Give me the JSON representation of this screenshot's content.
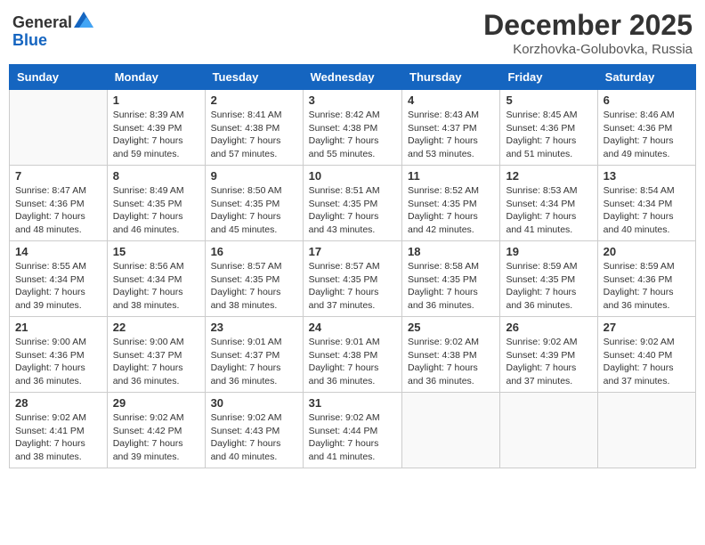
{
  "header": {
    "logo_general": "General",
    "logo_blue": "Blue",
    "title": "December 2025",
    "location": "Korzhovka-Golubovka, Russia"
  },
  "weekdays": [
    "Sunday",
    "Monday",
    "Tuesday",
    "Wednesday",
    "Thursday",
    "Friday",
    "Saturday"
  ],
  "weeks": [
    [
      {
        "day": "",
        "info": ""
      },
      {
        "day": "1",
        "info": "Sunrise: 8:39 AM\nSunset: 4:39 PM\nDaylight: 7 hours\nand 59 minutes."
      },
      {
        "day": "2",
        "info": "Sunrise: 8:41 AM\nSunset: 4:38 PM\nDaylight: 7 hours\nand 57 minutes."
      },
      {
        "day": "3",
        "info": "Sunrise: 8:42 AM\nSunset: 4:38 PM\nDaylight: 7 hours\nand 55 minutes."
      },
      {
        "day": "4",
        "info": "Sunrise: 8:43 AM\nSunset: 4:37 PM\nDaylight: 7 hours\nand 53 minutes."
      },
      {
        "day": "5",
        "info": "Sunrise: 8:45 AM\nSunset: 4:36 PM\nDaylight: 7 hours\nand 51 minutes."
      },
      {
        "day": "6",
        "info": "Sunrise: 8:46 AM\nSunset: 4:36 PM\nDaylight: 7 hours\nand 49 minutes."
      }
    ],
    [
      {
        "day": "7",
        "info": "Sunrise: 8:47 AM\nSunset: 4:36 PM\nDaylight: 7 hours\nand 48 minutes."
      },
      {
        "day": "8",
        "info": "Sunrise: 8:49 AM\nSunset: 4:35 PM\nDaylight: 7 hours\nand 46 minutes."
      },
      {
        "day": "9",
        "info": "Sunrise: 8:50 AM\nSunset: 4:35 PM\nDaylight: 7 hours\nand 45 minutes."
      },
      {
        "day": "10",
        "info": "Sunrise: 8:51 AM\nSunset: 4:35 PM\nDaylight: 7 hours\nand 43 minutes."
      },
      {
        "day": "11",
        "info": "Sunrise: 8:52 AM\nSunset: 4:35 PM\nDaylight: 7 hours\nand 42 minutes."
      },
      {
        "day": "12",
        "info": "Sunrise: 8:53 AM\nSunset: 4:34 PM\nDaylight: 7 hours\nand 41 minutes."
      },
      {
        "day": "13",
        "info": "Sunrise: 8:54 AM\nSunset: 4:34 PM\nDaylight: 7 hours\nand 40 minutes."
      }
    ],
    [
      {
        "day": "14",
        "info": "Sunrise: 8:55 AM\nSunset: 4:34 PM\nDaylight: 7 hours\nand 39 minutes."
      },
      {
        "day": "15",
        "info": "Sunrise: 8:56 AM\nSunset: 4:34 PM\nDaylight: 7 hours\nand 38 minutes."
      },
      {
        "day": "16",
        "info": "Sunrise: 8:57 AM\nSunset: 4:35 PM\nDaylight: 7 hours\nand 38 minutes."
      },
      {
        "day": "17",
        "info": "Sunrise: 8:57 AM\nSunset: 4:35 PM\nDaylight: 7 hours\nand 37 minutes."
      },
      {
        "day": "18",
        "info": "Sunrise: 8:58 AM\nSunset: 4:35 PM\nDaylight: 7 hours\nand 36 minutes."
      },
      {
        "day": "19",
        "info": "Sunrise: 8:59 AM\nSunset: 4:35 PM\nDaylight: 7 hours\nand 36 minutes."
      },
      {
        "day": "20",
        "info": "Sunrise: 8:59 AM\nSunset: 4:36 PM\nDaylight: 7 hours\nand 36 minutes."
      }
    ],
    [
      {
        "day": "21",
        "info": "Sunrise: 9:00 AM\nSunset: 4:36 PM\nDaylight: 7 hours\nand 36 minutes."
      },
      {
        "day": "22",
        "info": "Sunrise: 9:00 AM\nSunset: 4:37 PM\nDaylight: 7 hours\nand 36 minutes."
      },
      {
        "day": "23",
        "info": "Sunrise: 9:01 AM\nSunset: 4:37 PM\nDaylight: 7 hours\nand 36 minutes."
      },
      {
        "day": "24",
        "info": "Sunrise: 9:01 AM\nSunset: 4:38 PM\nDaylight: 7 hours\nand 36 minutes."
      },
      {
        "day": "25",
        "info": "Sunrise: 9:02 AM\nSunset: 4:38 PM\nDaylight: 7 hours\nand 36 minutes."
      },
      {
        "day": "26",
        "info": "Sunrise: 9:02 AM\nSunset: 4:39 PM\nDaylight: 7 hours\nand 37 minutes."
      },
      {
        "day": "27",
        "info": "Sunrise: 9:02 AM\nSunset: 4:40 PM\nDaylight: 7 hours\nand 37 minutes."
      }
    ],
    [
      {
        "day": "28",
        "info": "Sunrise: 9:02 AM\nSunset: 4:41 PM\nDaylight: 7 hours\nand 38 minutes."
      },
      {
        "day": "29",
        "info": "Sunrise: 9:02 AM\nSunset: 4:42 PM\nDaylight: 7 hours\nand 39 minutes."
      },
      {
        "day": "30",
        "info": "Sunrise: 9:02 AM\nSunset: 4:43 PM\nDaylight: 7 hours\nand 40 minutes."
      },
      {
        "day": "31",
        "info": "Sunrise: 9:02 AM\nSunset: 4:44 PM\nDaylight: 7 hours\nand 41 minutes."
      },
      {
        "day": "",
        "info": ""
      },
      {
        "day": "",
        "info": ""
      },
      {
        "day": "",
        "info": ""
      }
    ]
  ]
}
